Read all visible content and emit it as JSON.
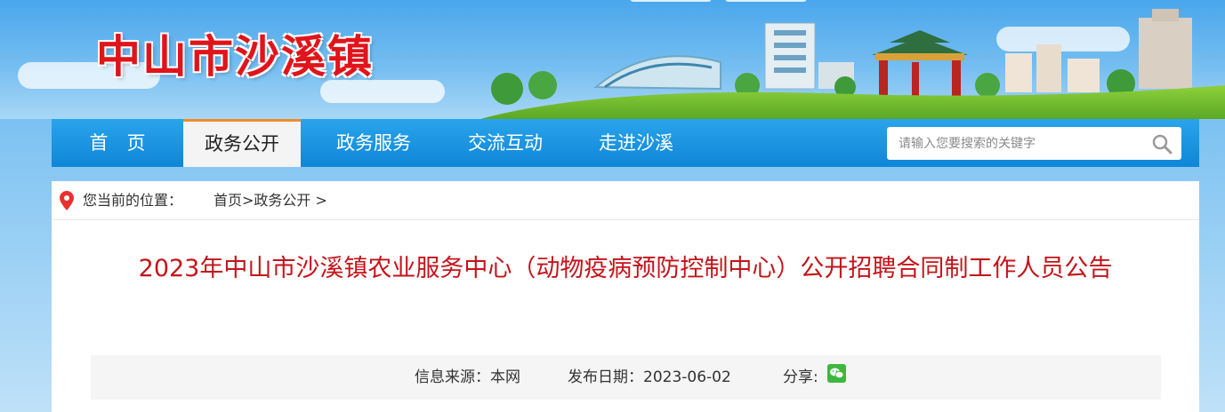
{
  "site": {
    "name": "中山市沙溪镇"
  },
  "nav": {
    "items": [
      {
        "label": "首　页"
      },
      {
        "label": "政务公开",
        "active": true
      },
      {
        "label": "政务服务"
      },
      {
        "label": "交流互动"
      },
      {
        "label": "走进沙溪"
      }
    ]
  },
  "search": {
    "placeholder": "请输入您要搜索的关键字",
    "value": ""
  },
  "breadcrumb": {
    "prefix": "您当前的位置：",
    "path": "首页>政务公开 >"
  },
  "article": {
    "title": "2023年中山市沙溪镇农业服务中心（动物疫病预防控制中心）公开招聘合同制工作人员公告",
    "source": "信息来源：本网",
    "date": "发布日期：2023-06-02",
    "share": "分享:"
  },
  "colors": {
    "site_name": "#e0141b",
    "title": "#c4141b",
    "nav_bg": "#1894df",
    "nav_active_accent": "#f08c2a"
  },
  "icons": [
    "search-icon",
    "location-pin-icon",
    "wechat-icon"
  ]
}
